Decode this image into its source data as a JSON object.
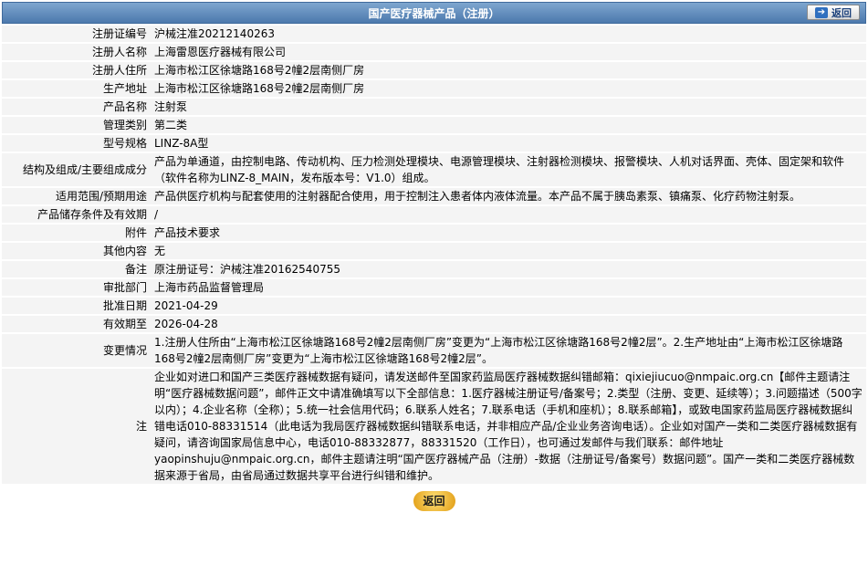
{
  "header": {
    "title": "国产医疗器械产品（注册）",
    "back_label": "返回"
  },
  "rows": [
    {
      "label": "注册证编号",
      "value": "沪械注准20212140263"
    },
    {
      "label": "注册人名称",
      "value": "上海雷恩医疗器械有限公司"
    },
    {
      "label": "注册人住所",
      "value": "上海市松江区徐塘路168号2幢2层南侧厂房"
    },
    {
      "label": "生产地址",
      "value": "上海市松江区徐塘路168号2幢2层南侧厂房"
    },
    {
      "label": "产品名称",
      "value": "注射泵"
    },
    {
      "label": "管理类别",
      "value": "第二类"
    },
    {
      "label": "型号规格",
      "value": "LINZ-8A型"
    },
    {
      "label": "结构及组成/主要组成成分",
      "value": "产品为单通道，由控制电路、传动机构、压力检测处理模块、电源管理模块、注射器检测模块、报警模块、人机对话界面、壳体、固定架和软件（软件名称为LINZ-8_MAIN，发布版本号：V1.0）组成。"
    },
    {
      "label": "适用范围/预期用途",
      "value": "产品供医疗机构与配套使用的注射器配合使用，用于控制注入患者体内液体流量。本产品不属于胰岛素泵、镇痛泵、化疗药物注射泵。"
    },
    {
      "label": "产品储存条件及有效期",
      "value": "/"
    },
    {
      "label": "附件",
      "value": "产品技术要求"
    },
    {
      "label": "其他内容",
      "value": "无"
    },
    {
      "label": "备注",
      "value": "原注册证号：沪械注准20162540755"
    },
    {
      "label": "审批部门",
      "value": "上海市药品监督管理局"
    },
    {
      "label": "批准日期",
      "value": "2021-04-29"
    },
    {
      "label": "有效期至",
      "value": "2026-04-28"
    },
    {
      "label": "变更情况",
      "value": "1.注册人住所由“上海市松江区徐塘路168号2幢2层南侧厂房”变更为“上海市松江区徐塘路168号2幢2层”。2.生产地址由“上海市松江区徐塘路168号2幢2层南侧厂房”变更为“上海市松江区徐塘路168号2幢2层”。"
    },
    {
      "label": "注",
      "value": "企业如对进口和国产三类医疗器械数据有疑问，请发送邮件至国家药监局医疗器械数据纠错邮箱：qixiejiucuo@nmpaic.org.cn【邮件主题请注明“医疗器械数据问题”，邮件正文中请准确填写以下全部信息：1.医疗器械注册证号/备案号；2.类型（注册、变更、延续等）；3.问题描述（500字以内）；4.企业名称（全称）；5.统一社会信用代码；6.联系人姓名；7.联系电话（手机和座机）；8.联系邮箱】，或致电国家药监局医疗器械数据纠错电话010-88331514（此电话为我局医疗器械数据纠错联系电话，并非相应产品/企业业务咨询电话）。企业如对国产一类和二类医疗器械数据有疑问，请咨询国家局信息中心，电话010-88332877，88331520（工作日），也可通过发邮件与我们联系：邮件地址yaopinshuju@nmpaic.org.cn，邮件主题请注明“国产医疗器械产品（注册）-数据（注册证号/备案号）数据问题”。国产一类和二类医疗器械数据来源于省局，由省局通过数据共享平台进行纠错和维护。"
    }
  ],
  "footer": {
    "back_label": "返回"
  },
  "colors": {
    "header_bg": "#5b86b8",
    "row_bg": "#f4f4f4",
    "button_gold": "#e09a10"
  }
}
